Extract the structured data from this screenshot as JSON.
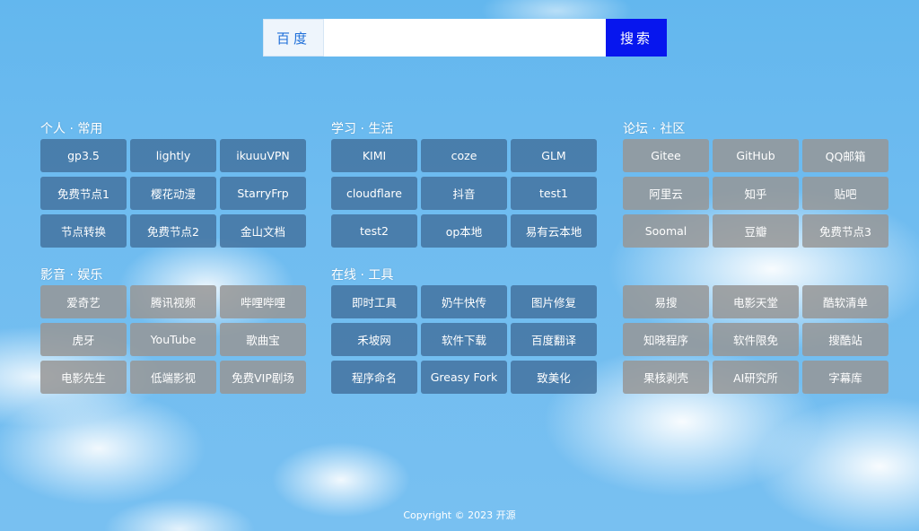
{
  "search": {
    "engine_label": "百度",
    "input_value": "",
    "placeholder": "",
    "button_label": "搜索"
  },
  "groups": [
    {
      "title": "个人 · 常用",
      "items": [
        "gp3.5",
        "lightly",
        "ikuuuVPN",
        "免费节点1",
        "樱花动漫",
        "StarryFrp",
        "节点转换",
        "免费节点2",
        "金山文档"
      ]
    },
    {
      "title": "学习 · 生活",
      "items": [
        "KIMI",
        "coze",
        "GLM",
        "cloudflare",
        "抖音",
        "test1",
        "test2",
        "op本地",
        "易有云本地"
      ]
    },
    {
      "title": "论坛 · 社区",
      "items": [
        "Gitee",
        "GitHub",
        "QQ邮箱",
        "阿里云",
        "知乎",
        "贴吧",
        "Soomal",
        "豆瓣",
        "免费节点3"
      ]
    },
    {
      "title": "影音 · 娱乐",
      "items": [
        "爱奇艺",
        "腾讯视频",
        "哔哩哔哩",
        "虎牙",
        "YouTube",
        "歌曲宝",
        "电影先生",
        "低端影视",
        "免费VIP剧场"
      ]
    },
    {
      "title": "在线 · 工具",
      "items": [
        "即时工具",
        "奶牛快传",
        "图片修复",
        "禾坡网",
        "软件下载",
        "百度翻译",
        "程序命名",
        "Greasy Fork",
        "致美化"
      ]
    },
    {
      "title": "",
      "items": [
        "易搜",
        "电影天堂",
        "酷软清单",
        "知晓程序",
        "软件限免",
        "搜酷站",
        "果核剥壳",
        "AI研究所",
        "字幕库"
      ]
    }
  ],
  "footer": {
    "text": "Copyright © 2023 开源"
  },
  "colors": {
    "search_button": "#0716ee",
    "engine_text": "#1e6fd9",
    "blue_tile": "#42709c",
    "gray_tile": "#969696"
  }
}
